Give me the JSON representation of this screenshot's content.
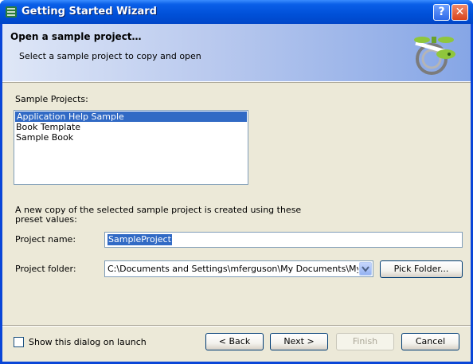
{
  "window": {
    "title": "Getting Started Wizard",
    "help_glyph": "?",
    "close_glyph": "✕"
  },
  "header": {
    "title": "Open a sample project…",
    "subtitle": "Select a sample project to copy and open",
    "logo_icon": "propeller-logo-icon"
  },
  "sample_projects": {
    "label": "Sample Projects:",
    "items": [
      "Application Help Sample",
      "Book Template",
      "Sample Book"
    ],
    "selected_index": 0
  },
  "info_text": "A new copy of the selected sample project is created using these preset values:",
  "project_name": {
    "label": "Project name:",
    "value": "SampleProject"
  },
  "project_folder": {
    "label": "Project folder:",
    "value": "C:\\Documents and Settings\\mferguson\\My Documents\\My Project",
    "pick_label": "Pick Folder..."
  },
  "show_on_launch": {
    "label": "Show this dialog on launch",
    "checked": false
  },
  "buttons": {
    "back": "< Back",
    "next": "Next >",
    "finish": "Finish",
    "cancel": "Cancel"
  },
  "colors": {
    "title_bar": "#0050d8",
    "selection": "#316ac5",
    "dialog_bg": "#ece9d8"
  }
}
